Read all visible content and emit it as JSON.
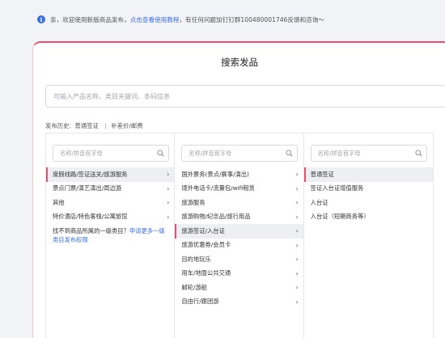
{
  "notice": {
    "icon": "info-icon",
    "text_before": "亲，欢迎使用新版商品发布，",
    "link_text": "点击查看使用教程",
    "text_after": "，有任何问题加钉钉群100480001746反馈和咨询～"
  },
  "colors": {
    "accent": "#ec4d6f",
    "link": "#3a6fe6"
  },
  "card": {
    "title": "搜索发品",
    "search_placeholder": "可输入产品名称、类目关键词、条码信息"
  },
  "history": {
    "label": "发布历史:",
    "items": [
      "普通签证",
      "补差价/邮费"
    ],
    "separator": "|"
  },
  "columns": [
    {
      "search_placeholder": "名称/拼音首字母",
      "items": [
        {
          "label": "度假线路/签证送关/旅游服务",
          "selected": true,
          "arrow": "›"
        },
        {
          "label": "景点门票/演艺演出/周边游",
          "selected": false,
          "arrow": "›"
        },
        {
          "label": "其他",
          "selected": false,
          "arrow": "›"
        },
        {
          "label": "特价酒店/特色客栈/公寓旅馆",
          "selected": false,
          "arrow": "›"
        }
      ],
      "note": {
        "text": "找不到商品所属的一级类目？",
        "link": "申请更多一级类目发布权限"
      }
    },
    {
      "search_placeholder": "名称/拼音首字母",
      "items": [
        {
          "label": "国外票务(景点/赛事/演出)",
          "selected": false,
          "arrow": "›"
        },
        {
          "label": "境外电话卡/流量包/wifi租赁",
          "selected": false,
          "arrow": "›"
        },
        {
          "label": "旅游服务",
          "selected": false,
          "arrow": "›"
        },
        {
          "label": "旅游购物/纪念品/旅行用品",
          "selected": false,
          "arrow": "›"
        },
        {
          "label": "旅游签证/入台证",
          "selected": true,
          "arrow": "›"
        },
        {
          "label": "旅游优惠券/会员卡",
          "selected": false,
          "arrow": "›"
        },
        {
          "label": "目的地玩乐",
          "selected": false,
          "arrow": "›"
        },
        {
          "label": "用车/地面公共交通",
          "selected": false,
          "arrow": "›"
        },
        {
          "label": "邮轮/游船",
          "selected": false,
          "arrow": "›"
        },
        {
          "label": "自由行/跟团游",
          "selected": false,
          "arrow": "›"
        }
      ]
    },
    {
      "search_placeholder": "名称/拼音首字母",
      "items": [
        {
          "label": "普通签证",
          "selected": true,
          "arrow": ""
        },
        {
          "label": "签证入台证增值服务",
          "selected": false,
          "arrow": ""
        },
        {
          "label": "入台证",
          "selected": false,
          "arrow": ""
        },
        {
          "label": "入台证（短期商务等）",
          "selected": false,
          "arrow": ""
        }
      ]
    }
  ]
}
